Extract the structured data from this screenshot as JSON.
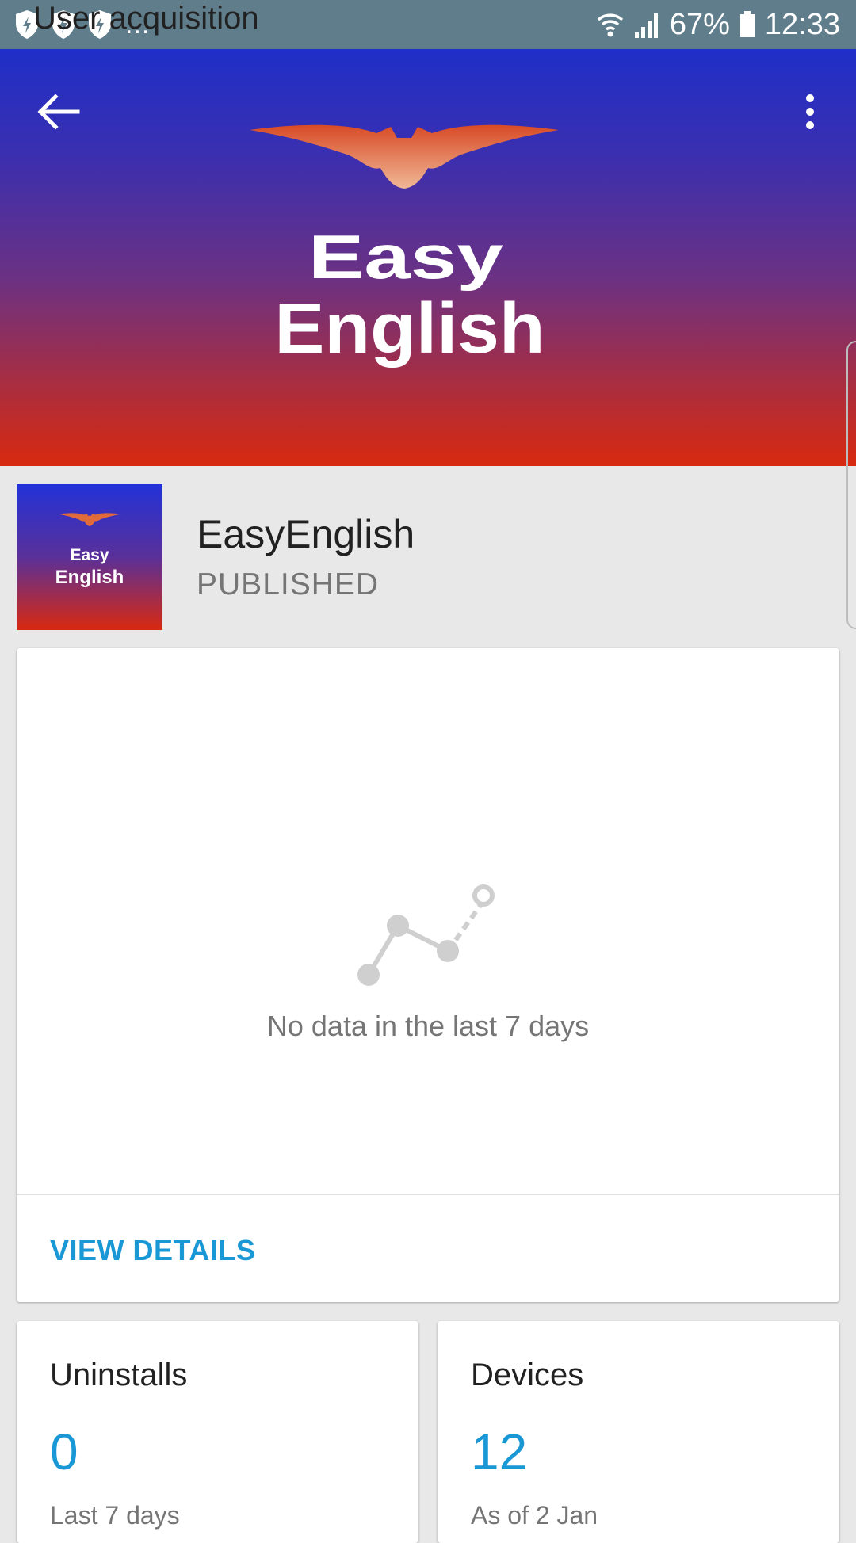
{
  "status_bar": {
    "overflow": "...",
    "battery": "67%",
    "time": "12:33",
    "icons": [
      "shield-icon",
      "shield-icon",
      "shield-icon",
      "wifi-icon",
      "signal-icon",
      "battery-icon"
    ]
  },
  "hero": {
    "title_line1": "Easy",
    "title_line2": "English",
    "colors": {
      "top": "#1f2fc8",
      "bottom": "#d8290f",
      "bat": "#e06a3c"
    }
  },
  "app": {
    "icon_line1": "Easy",
    "icon_line2": "English",
    "name": "EasyEnglish",
    "status": "PUBLISHED"
  },
  "acquisition": {
    "title": "User acquisition",
    "empty_message": "No data in the last 7 days",
    "action": "VIEW DETAILS"
  },
  "uninstalls": {
    "title": "Uninstalls",
    "value": "0",
    "caption": "Last 7 days"
  },
  "devices": {
    "title": "Devices",
    "value": "12",
    "caption": "As of 2 Jan"
  },
  "accent_color": "#1a97d5"
}
